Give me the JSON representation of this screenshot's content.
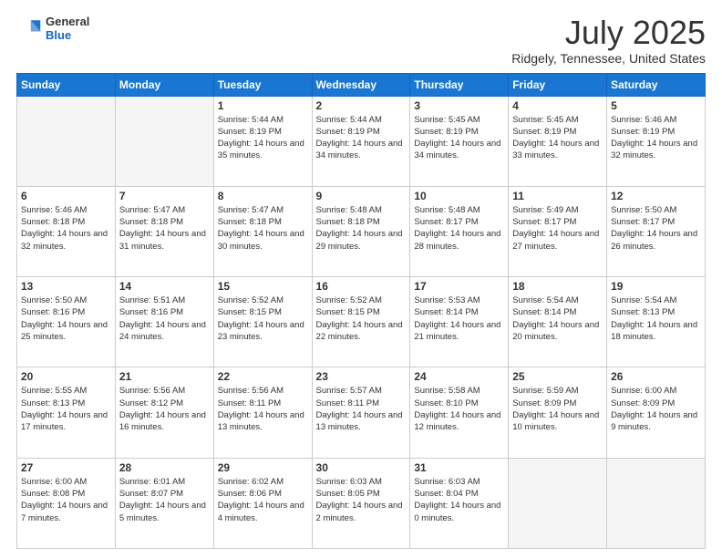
{
  "header": {
    "logo": {
      "general": "General",
      "blue": "Blue"
    },
    "title": "July 2025",
    "location": "Ridgely, Tennessee, United States"
  },
  "weekdays": [
    "Sunday",
    "Monday",
    "Tuesday",
    "Wednesday",
    "Thursday",
    "Friday",
    "Saturday"
  ],
  "weeks": [
    [
      {
        "day": "",
        "empty": true
      },
      {
        "day": "",
        "empty": true
      },
      {
        "day": "1",
        "sunrise": "Sunrise: 5:44 AM",
        "sunset": "Sunset: 8:19 PM",
        "daylight": "Daylight: 14 hours and 35 minutes."
      },
      {
        "day": "2",
        "sunrise": "Sunrise: 5:44 AM",
        "sunset": "Sunset: 8:19 PM",
        "daylight": "Daylight: 14 hours and 34 minutes."
      },
      {
        "day": "3",
        "sunrise": "Sunrise: 5:45 AM",
        "sunset": "Sunset: 8:19 PM",
        "daylight": "Daylight: 14 hours and 34 minutes."
      },
      {
        "day": "4",
        "sunrise": "Sunrise: 5:45 AM",
        "sunset": "Sunset: 8:19 PM",
        "daylight": "Daylight: 14 hours and 33 minutes."
      },
      {
        "day": "5",
        "sunrise": "Sunrise: 5:46 AM",
        "sunset": "Sunset: 8:19 PM",
        "daylight": "Daylight: 14 hours and 32 minutes."
      }
    ],
    [
      {
        "day": "6",
        "sunrise": "Sunrise: 5:46 AM",
        "sunset": "Sunset: 8:18 PM",
        "daylight": "Daylight: 14 hours and 32 minutes."
      },
      {
        "day": "7",
        "sunrise": "Sunrise: 5:47 AM",
        "sunset": "Sunset: 8:18 PM",
        "daylight": "Daylight: 14 hours and 31 minutes."
      },
      {
        "day": "8",
        "sunrise": "Sunrise: 5:47 AM",
        "sunset": "Sunset: 8:18 PM",
        "daylight": "Daylight: 14 hours and 30 minutes."
      },
      {
        "day": "9",
        "sunrise": "Sunrise: 5:48 AM",
        "sunset": "Sunset: 8:18 PM",
        "daylight": "Daylight: 14 hours and 29 minutes."
      },
      {
        "day": "10",
        "sunrise": "Sunrise: 5:48 AM",
        "sunset": "Sunset: 8:17 PM",
        "daylight": "Daylight: 14 hours and 28 minutes."
      },
      {
        "day": "11",
        "sunrise": "Sunrise: 5:49 AM",
        "sunset": "Sunset: 8:17 PM",
        "daylight": "Daylight: 14 hours and 27 minutes."
      },
      {
        "day": "12",
        "sunrise": "Sunrise: 5:50 AM",
        "sunset": "Sunset: 8:17 PM",
        "daylight": "Daylight: 14 hours and 26 minutes."
      }
    ],
    [
      {
        "day": "13",
        "sunrise": "Sunrise: 5:50 AM",
        "sunset": "Sunset: 8:16 PM",
        "daylight": "Daylight: 14 hours and 25 minutes."
      },
      {
        "day": "14",
        "sunrise": "Sunrise: 5:51 AM",
        "sunset": "Sunset: 8:16 PM",
        "daylight": "Daylight: 14 hours and 24 minutes."
      },
      {
        "day": "15",
        "sunrise": "Sunrise: 5:52 AM",
        "sunset": "Sunset: 8:15 PM",
        "daylight": "Daylight: 14 hours and 23 minutes."
      },
      {
        "day": "16",
        "sunrise": "Sunrise: 5:52 AM",
        "sunset": "Sunset: 8:15 PM",
        "daylight": "Daylight: 14 hours and 22 minutes."
      },
      {
        "day": "17",
        "sunrise": "Sunrise: 5:53 AM",
        "sunset": "Sunset: 8:14 PM",
        "daylight": "Daylight: 14 hours and 21 minutes."
      },
      {
        "day": "18",
        "sunrise": "Sunrise: 5:54 AM",
        "sunset": "Sunset: 8:14 PM",
        "daylight": "Daylight: 14 hours and 20 minutes."
      },
      {
        "day": "19",
        "sunrise": "Sunrise: 5:54 AM",
        "sunset": "Sunset: 8:13 PM",
        "daylight": "Daylight: 14 hours and 18 minutes."
      }
    ],
    [
      {
        "day": "20",
        "sunrise": "Sunrise: 5:55 AM",
        "sunset": "Sunset: 8:13 PM",
        "daylight": "Daylight: 14 hours and 17 minutes."
      },
      {
        "day": "21",
        "sunrise": "Sunrise: 5:56 AM",
        "sunset": "Sunset: 8:12 PM",
        "daylight": "Daylight: 14 hours and 16 minutes."
      },
      {
        "day": "22",
        "sunrise": "Sunrise: 5:56 AM",
        "sunset": "Sunset: 8:11 PM",
        "daylight": "Daylight: 14 hours and 13 minutes."
      },
      {
        "day": "23",
        "sunrise": "Sunrise: 5:57 AM",
        "sunset": "Sunset: 8:11 PM",
        "daylight": "Daylight: 14 hours and 13 minutes."
      },
      {
        "day": "24",
        "sunrise": "Sunrise: 5:58 AM",
        "sunset": "Sunset: 8:10 PM",
        "daylight": "Daylight: 14 hours and 12 minutes."
      },
      {
        "day": "25",
        "sunrise": "Sunrise: 5:59 AM",
        "sunset": "Sunset: 8:09 PM",
        "daylight": "Daylight: 14 hours and 10 minutes."
      },
      {
        "day": "26",
        "sunrise": "Sunrise: 6:00 AM",
        "sunset": "Sunset: 8:09 PM",
        "daylight": "Daylight: 14 hours and 9 minutes."
      }
    ],
    [
      {
        "day": "27",
        "sunrise": "Sunrise: 6:00 AM",
        "sunset": "Sunset: 8:08 PM",
        "daylight": "Daylight: 14 hours and 7 minutes."
      },
      {
        "day": "28",
        "sunrise": "Sunrise: 6:01 AM",
        "sunset": "Sunset: 8:07 PM",
        "daylight": "Daylight: 14 hours and 5 minutes."
      },
      {
        "day": "29",
        "sunrise": "Sunrise: 6:02 AM",
        "sunset": "Sunset: 8:06 PM",
        "daylight": "Daylight: 14 hours and 4 minutes."
      },
      {
        "day": "30",
        "sunrise": "Sunrise: 6:03 AM",
        "sunset": "Sunset: 8:05 PM",
        "daylight": "Daylight: 14 hours and 2 minutes."
      },
      {
        "day": "31",
        "sunrise": "Sunrise: 6:03 AM",
        "sunset": "Sunset: 8:04 PM",
        "daylight": "Daylight: 14 hours and 0 minutes."
      },
      {
        "day": "",
        "empty": true
      },
      {
        "day": "",
        "empty": true
      }
    ]
  ]
}
